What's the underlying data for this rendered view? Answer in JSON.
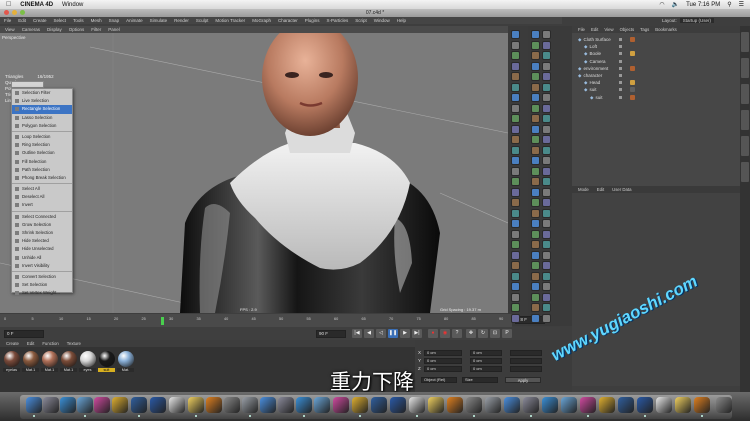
{
  "mac_menubar": {
    "app_name": "CINEMA 4D",
    "window_menu": "Window",
    "clock": "Tue 7:16 PM"
  },
  "window": {
    "title": "07.c4d *"
  },
  "main_menu": [
    "File",
    "Edit",
    "Create",
    "Select",
    "Tools",
    "Mesh",
    "Snap",
    "Animate",
    "Simulate",
    "Render",
    "Sculpt",
    "Motion Tracker",
    "MoGraph",
    "Character",
    "Plugins",
    "X-Particles",
    "Script",
    "Window",
    "Help"
  ],
  "layout": {
    "label": "Layout:",
    "value": "Startup (User)"
  },
  "viewport": {
    "menu": [
      "View",
      "Cameras",
      "Display",
      "Options",
      "Filter",
      "Panel"
    ],
    "label": "Perspective",
    "stats": [
      "Triangles",
      "Quad",
      "Poly",
      "Tris",
      "Line"
    ],
    "stats_value": "16/1952",
    "fps": "FPS : 2.9",
    "grid_spacing": "Grid Spacing : 19.37 m"
  },
  "context_menu": {
    "items": [
      {
        "label": "Selection Filter",
        "selected": false
      },
      {
        "label": "Live Selection",
        "selected": false
      },
      {
        "label": "Rectangle Selection",
        "selected": true
      },
      {
        "label": "Lasso Selection",
        "selected": false
      },
      {
        "label": "Polygon Selection",
        "selected": false
      },
      {
        "sep": true
      },
      {
        "label": "Loop Selection",
        "selected": false
      },
      {
        "label": "Ring Selection",
        "selected": false
      },
      {
        "label": "Outline Selection",
        "selected": false
      },
      {
        "label": "Fill Selection",
        "selected": false
      },
      {
        "label": "Path Selection",
        "selected": false
      },
      {
        "label": "Phong Break Selection",
        "selected": false
      },
      {
        "sep": true
      },
      {
        "label": "Select All",
        "selected": false
      },
      {
        "label": "Deselect All",
        "selected": false
      },
      {
        "label": "Invert",
        "selected": false
      },
      {
        "sep": true
      },
      {
        "label": "Select Connected",
        "selected": false
      },
      {
        "label": "Grow Selection",
        "selected": false
      },
      {
        "label": "Shrink Selection",
        "selected": false
      },
      {
        "label": "Hide Selected",
        "selected": false
      },
      {
        "label": "Hide Unselected",
        "selected": false
      },
      {
        "label": "Unhide All",
        "selected": false
      },
      {
        "label": "Invert Visibility",
        "selected": false
      },
      {
        "sep": true
      },
      {
        "label": "Convert Selection",
        "selected": false
      },
      {
        "label": "Set Selection",
        "selected": false
      },
      {
        "label": "Set Vertex Weight...",
        "selected": false
      }
    ]
  },
  "object_manager": {
    "menu": [
      "File",
      "Edit",
      "View",
      "Objects",
      "Tags",
      "Bookmarks"
    ],
    "objects": [
      {
        "name": "Cloth Surface",
        "indent": 0
      },
      {
        "name": "Loft",
        "indent": 1
      },
      {
        "name": "Boole",
        "indent": 1
      },
      {
        "name": "Camera",
        "indent": 1
      },
      {
        "name": "environment",
        "indent": 0
      },
      {
        "name": "character",
        "indent": 0
      },
      {
        "name": "Head",
        "indent": 1
      },
      {
        "name": "suit",
        "indent": 1
      },
      {
        "name": "suit",
        "indent": 2
      }
    ]
  },
  "attribute_manager": {
    "menu": [
      "Mode",
      "Edit",
      "User Data"
    ]
  },
  "timeline": {
    "ticks": [
      "0",
      "5",
      "10",
      "15",
      "20",
      "25",
      "30",
      "35",
      "40",
      "45",
      "50",
      "55",
      "60",
      "65",
      "70",
      "75",
      "80",
      "85",
      "90"
    ],
    "start_field": "0 F",
    "end_field": "90 F",
    "current_frame": "28 F"
  },
  "material_manager": {
    "menu": [
      "Create",
      "Edit",
      "Function",
      "Texture"
    ],
    "materials": [
      {
        "label": "eyelas",
        "color": "#7a4a3a"
      },
      {
        "label": "Mat.1",
        "color": "#8a5a3e"
      },
      {
        "label": "Mat.1",
        "color": "#b07058"
      },
      {
        "label": "Mat.1",
        "color": "#7b4c38"
      },
      {
        "label": "eyes",
        "color": "#d8d8d8"
      },
      {
        "label": "suit",
        "color": "#1a1a1a"
      },
      {
        "label": "Mat.",
        "color": "#8ab0d8"
      }
    ]
  },
  "coordinates": {
    "labels": [
      "X",
      "Y",
      "Z"
    ],
    "values": [
      "0 cm",
      "0 cm",
      "0 cm"
    ],
    "mode": "Object (Rel)",
    "size_label": "Size",
    "apply_label": "Apply"
  },
  "subtitle": "重力下降",
  "watermark": "www.yugiaoshi.com",
  "colors": {
    "viewport_bg": "#7b7b7b",
    "selection_highlight": "#3c74c4",
    "watermark": "#5fd7ff"
  },
  "dock_icons": [
    "finder-icon",
    "launchpad-icon",
    "safari-icon",
    "mail-icon",
    "itunes-icon",
    "chrome-icon",
    "cinema4d-icon",
    "photoshop-icon",
    "calendar-icon",
    "notes-icon",
    "vlc-icon",
    "system-preferences-icon",
    "trash-icon"
  ]
}
